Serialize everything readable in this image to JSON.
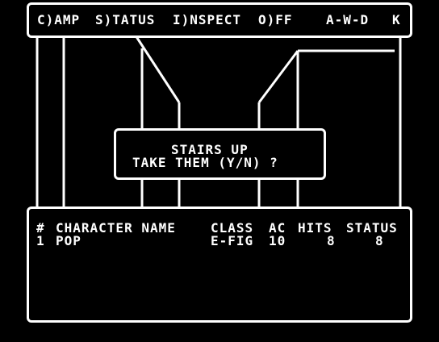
{
  "menu": {
    "camp": "C)AMP",
    "status": "S)TATUS",
    "inspect": "I)NSPECT",
    "off": "O)FF",
    "controls": "A-W-D",
    "k": "K"
  },
  "dialog": {
    "line1": "STAIRS UP",
    "line2": "TAKE THEM (Y/N) ?"
  },
  "party": {
    "headers": {
      "num": "#",
      "name": "CHARACTER NAME",
      "class": "CLASS",
      "ac": "AC",
      "hits": "HITS",
      "status": "STATUS"
    },
    "rows": [
      {
        "num": "1",
        "name": "POP",
        "class": "E-FIG",
        "ac": "10",
        "hits": "8",
        "status": "8"
      }
    ]
  },
  "colors": {
    "foreground": "#ffffff",
    "background": "#000000"
  }
}
